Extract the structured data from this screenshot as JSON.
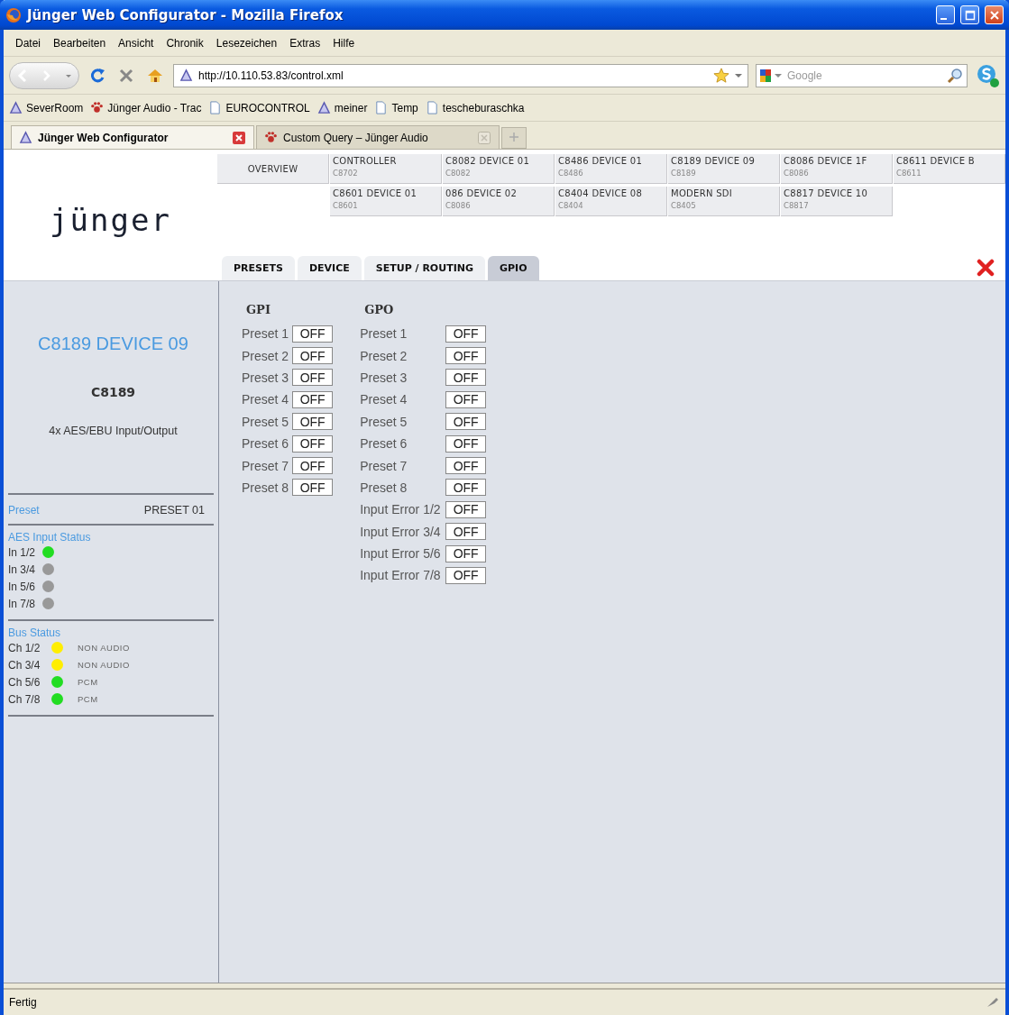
{
  "window": {
    "title": "Jünger Web Configurator - Mozilla Firefox"
  },
  "menu": [
    "Datei",
    "Bearbeiten",
    "Ansicht",
    "Chronik",
    "Lesezeichen",
    "Extras",
    "Hilfe"
  ],
  "toolbar": {
    "url": "http://10.110.53.83/control.xml",
    "search_placeholder": "Google"
  },
  "bookmarks": [
    {
      "label": "SeverRoom",
      "kind": "triangle"
    },
    {
      "label": "Jünger Audio - Trac",
      "kind": "paw"
    },
    {
      "label": "EUROCONTROL",
      "kind": "page"
    },
    {
      "label": "meiner",
      "kind": "triangle"
    },
    {
      "label": "Temp",
      "kind": "page"
    },
    {
      "label": "tescheburaschka",
      "kind": "page"
    }
  ],
  "browser_tabs": [
    {
      "label": "Jünger Web Configurator",
      "selected": true,
      "kind": "triangle"
    },
    {
      "label": "Custom Query – Jünger Audio",
      "selected": false,
      "kind": "paw"
    }
  ],
  "logo": "jünger",
  "device_nav": {
    "overview": "OVERVIEW",
    "devices": [
      {
        "name": "CONTROLLER",
        "model": "C8702"
      },
      {
        "name": "C8082 DEVICE 01",
        "model": "C8082"
      },
      {
        "name": "C8486 DEVICE 01",
        "model": "C8486"
      },
      {
        "name": "C8189 DEVICE 09",
        "model": "C8189"
      },
      {
        "name": "C8086 DEVICE 1F",
        "model": "C8086"
      },
      {
        "name": "C8611 DEVICE B",
        "model": "C8611"
      },
      {
        "name": "C8601 DEVICE 01",
        "model": "C8601"
      },
      {
        "name": "086 DEVICE 02",
        "model": "C8086"
      },
      {
        "name": "C8404 DEVICE 08",
        "model": "C8404"
      },
      {
        "name": "MODERN SDI",
        "model": "C8405"
      },
      {
        "name": "C8817 DEVICE 10",
        "model": "C8817"
      }
    ]
  },
  "page_tabs": [
    {
      "label": "PRESETS",
      "selected": false
    },
    {
      "label": "DEVICE",
      "selected": false
    },
    {
      "label": "SETUP / ROUTING",
      "selected": false
    },
    {
      "label": "GPIO",
      "selected": true
    }
  ],
  "sidebar": {
    "device_name": "C8189 DEVICE 09",
    "model": "C8189",
    "description": "4x AES/EBU Input/Output",
    "preset": {
      "label": "Preset",
      "value": "PRESET 01"
    },
    "aes_input_status": {
      "title": "AES Input Status",
      "inputs": [
        {
          "label": "In 1/2",
          "color": "#22dd22"
        },
        {
          "label": "In 3/4",
          "color": "#999999"
        },
        {
          "label": "In 5/6",
          "color": "#999999"
        },
        {
          "label": "In 7/8",
          "color": "#999999"
        }
      ]
    },
    "bus_status": {
      "title": "Bus Status",
      "channels": [
        {
          "label": "Ch 1/2",
          "color": "#ffee00",
          "format": "NON AUDIO"
        },
        {
          "label": "Ch 3/4",
          "color": "#ffee00",
          "format": "NON AUDIO"
        },
        {
          "label": "Ch 5/6",
          "color": "#22dd22",
          "format": "PCM"
        },
        {
          "label": "Ch 7/8",
          "color": "#22dd22",
          "format": "PCM"
        }
      ]
    }
  },
  "gpi": {
    "title": "GPI",
    "rows": [
      {
        "label": "Preset 1",
        "value": "OFF"
      },
      {
        "label": "Preset 2",
        "value": "OFF"
      },
      {
        "label": "Preset 3",
        "value": "OFF"
      },
      {
        "label": "Preset 4",
        "value": "OFF"
      },
      {
        "label": "Preset 5",
        "value": "OFF"
      },
      {
        "label": "Preset 6",
        "value": "OFF"
      },
      {
        "label": "Preset 7",
        "value": "OFF"
      },
      {
        "label": "Preset 8",
        "value": "OFF"
      }
    ]
  },
  "gpo": {
    "title": "GPO",
    "rows": [
      {
        "label": "Preset 1",
        "value": "OFF"
      },
      {
        "label": "Preset 2",
        "value": "OFF"
      },
      {
        "label": "Preset 3",
        "value": "OFF"
      },
      {
        "label": "Preset 4",
        "value": "OFF"
      },
      {
        "label": "Preset 5",
        "value": "OFF"
      },
      {
        "label": "Preset 6",
        "value": "OFF"
      },
      {
        "label": "Preset 7",
        "value": "OFF"
      },
      {
        "label": "Preset 8",
        "value": "OFF"
      },
      {
        "label": "Input Error 1/2",
        "value": "OFF"
      },
      {
        "label": "Input Error 3/4",
        "value": "OFF"
      },
      {
        "label": "Input Error 5/6",
        "value": "OFF"
      },
      {
        "label": "Input Error 7/8",
        "value": "OFF"
      }
    ]
  },
  "status_bar": {
    "text": "Fertig"
  }
}
